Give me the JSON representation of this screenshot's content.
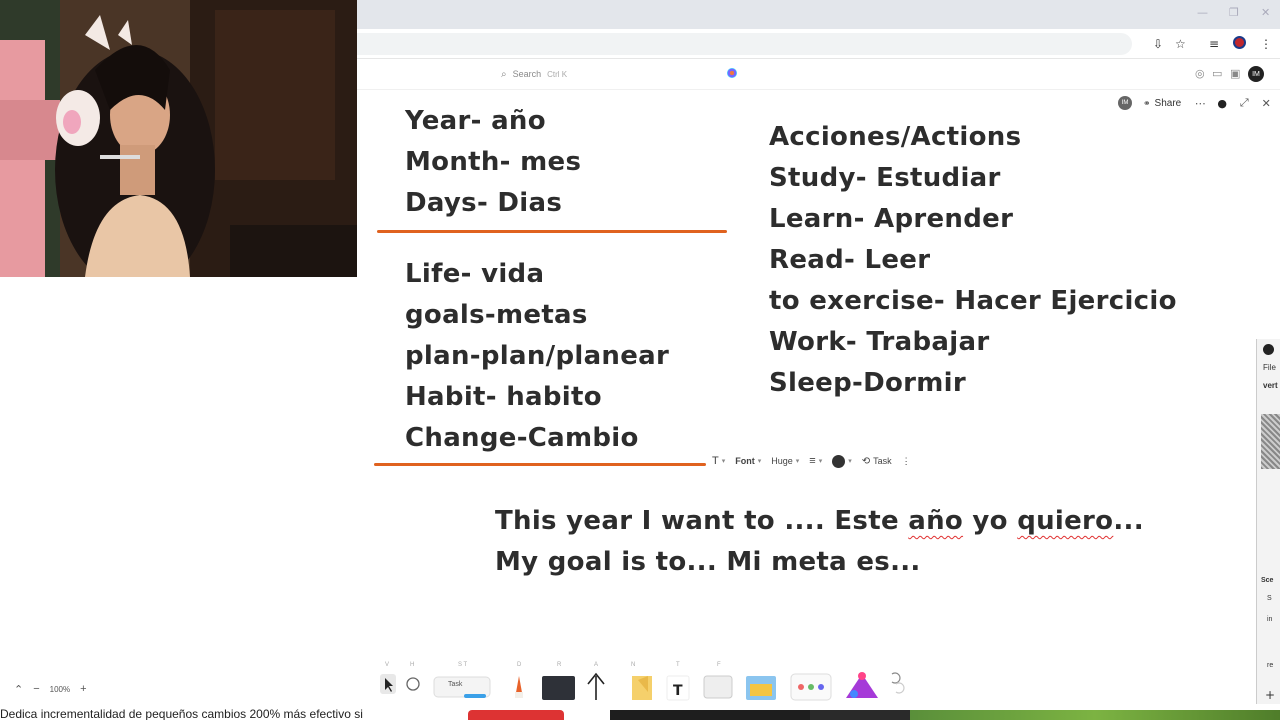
{
  "colors": {
    "accent_line": "#e0621f",
    "board_text": "#2d2d2d",
    "spell_underline": "#e03030"
  },
  "browser": {
    "search": {
      "placeholder": "Search",
      "shortcut": "Ctrl K"
    },
    "panel": {
      "avatar_initials": "IM",
      "share_label": "Share"
    }
  },
  "board": {
    "left_group_1": [
      "Year- año",
      "Month- mes",
      "Days- Dias"
    ],
    "left_group_2": [
      "Life- vida",
      "goals-metas",
      "plan-plan/planear",
      "Habit- habito",
      "Change-Cambio"
    ],
    "right_group": [
      "Acciones/Actions",
      "Study- Estudiar",
      "Learn- Aprender",
      "Read- Leer",
      "to exercise- Hacer Ejercicio",
      "Work- Trabajar",
      "Sleep-Dormir"
    ],
    "sentence_1": {
      "a": "This year I ",
      "b": "want",
      "c": " to .... Este ",
      "d": "año",
      "e": " yo ",
      "f": "quiero",
      "g": "..."
    },
    "sentence_2": "My goal is to... Mi meta es..."
  },
  "text_toolbar": {
    "type_icon": "T",
    "font_label": "Font",
    "size_label": "Huge",
    "align_icon": "≡",
    "task_label": "Task",
    "more_icon": "⋮"
  },
  "dock": {
    "task_label": "Task",
    "text_tool": "T",
    "keys": [
      "V",
      "H",
      "S T",
      "D",
      "R",
      "A",
      "N",
      "T",
      "F"
    ]
  },
  "zoom": {
    "level": "100%",
    "minus": "−",
    "plus": "+"
  },
  "side_window": {
    "menu_file": "File",
    "item_1": "vert",
    "item_2": "Sce",
    "item_3": "S",
    "item_4": "in",
    "item_5": "re"
  },
  "caption": "Dedica incrementalidad de pequeños cambios 200% más efectivo si"
}
